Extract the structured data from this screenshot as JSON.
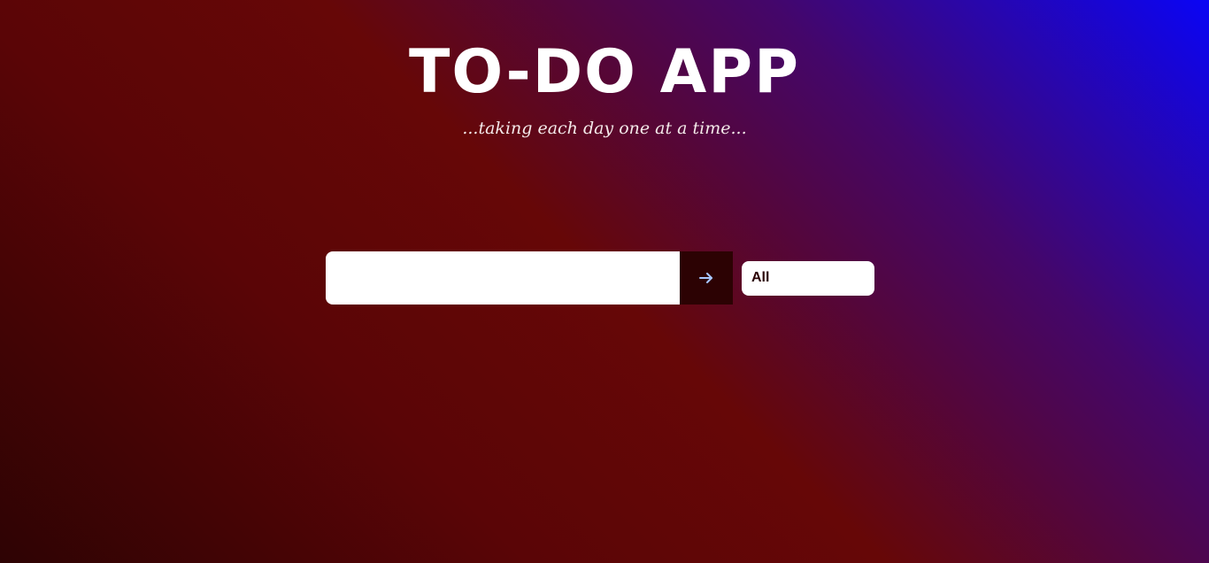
{
  "header": {
    "title": "TO-DO APP",
    "subtitle": "...taking each day one at a time..."
  },
  "form": {
    "input_value": "",
    "input_placeholder": "",
    "submit_icon": "arrow-right-icon",
    "filter": {
      "selected": "All"
    }
  },
  "colors": {
    "gradient_start": "#2e0304",
    "gradient_mid": "#660707",
    "gradient_end": "#0a05f5",
    "button_bg": "#2c0203",
    "arrow_color": "#a9c7ff",
    "dark_text": "#2b0204"
  }
}
